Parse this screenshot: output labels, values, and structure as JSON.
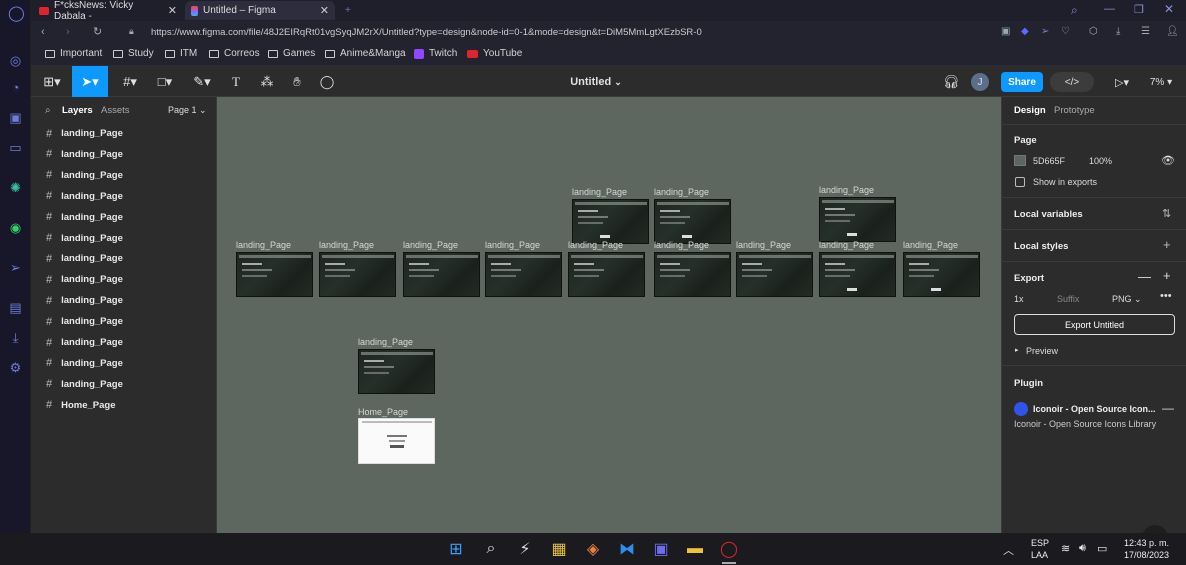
{
  "browser": {
    "tabs": [
      {
        "title": "F*cksNews: Vicky Dabala -",
        "active": false
      },
      {
        "title": "Untitled – Figma",
        "active": true
      }
    ],
    "new_tab": "+",
    "url": "https://www.figma.com/file/48J2EIRqRt01vgSyqJM2rX/Untitled?type=design&node-id=0-1&mode=design&t=DiM5MmLgtXEzbSR-0",
    "bookmarks": [
      "Important",
      "Study",
      "ITM",
      "Correos",
      "Games",
      "Anime&Manga",
      "Twitch",
      "YouTube"
    ]
  },
  "toolbar": {
    "file_title": "Untitled",
    "avatar_initial": "J",
    "share_label": "Share",
    "zoom": "7%"
  },
  "layers_panel": {
    "tab_layers": "Layers",
    "tab_assets": "Assets",
    "page_selector": "Page 1",
    "items": [
      "landing_Page",
      "landing_Page",
      "landing_Page",
      "landing_Page",
      "landing_Page",
      "landing_Page",
      "landing_Page",
      "landing_Page",
      "landing_Page",
      "landing_Page",
      "landing_Page",
      "landing_Page",
      "landing_Page",
      "Home_Page"
    ]
  },
  "canvas": {
    "background": "#5D665F",
    "frame_label": "landing_Page",
    "home_label": "Home_Page"
  },
  "right_panel": {
    "tab_design": "Design",
    "tab_prototype": "Prototype",
    "page_heading": "Page",
    "page_color": "5D665F",
    "page_opacity": "100%",
    "show_in_exports": "Show in exports",
    "local_variables": "Local variables",
    "local_styles": "Local styles",
    "export_heading": "Export",
    "export_scale": "1x",
    "export_suffix_placeholder": "Suffix",
    "export_format": "PNG",
    "export_button": "Export Untitled",
    "preview": "Preview",
    "plugin_heading": "Plugin",
    "plugin_name": "Iconoir - Open Source Icon...",
    "plugin_desc": "Iconoir - Open Source Icons Library"
  },
  "taskbar": {
    "lang": "ESP",
    "lang_sub": "LAA",
    "time": "12:43 p. m.",
    "date": "17/08/2023"
  },
  "colors": {
    "accent": "#0d99ff",
    "canvas": "#5D665F",
    "opera_red": "#e0242e"
  }
}
